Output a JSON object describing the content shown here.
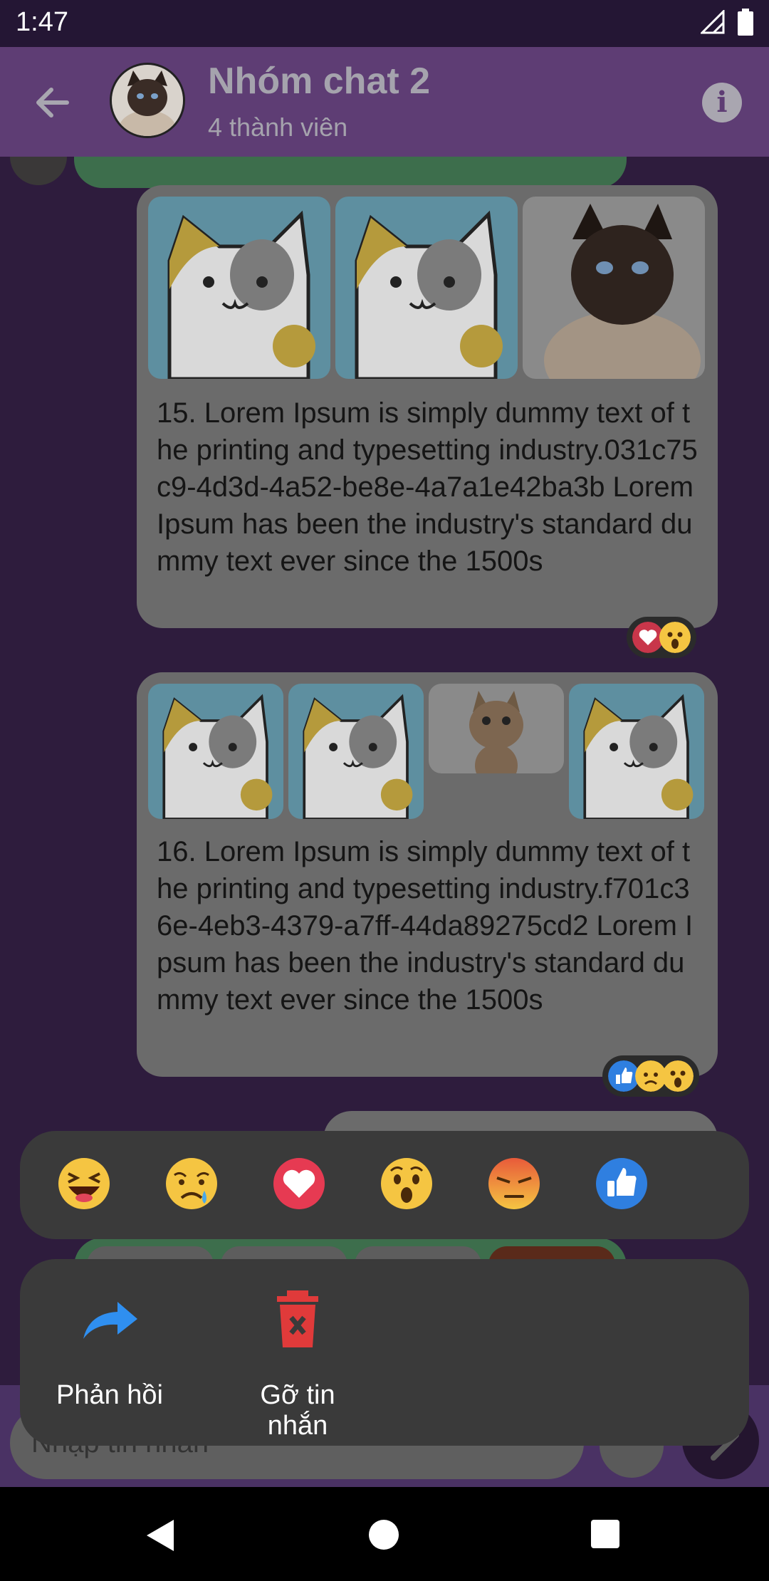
{
  "status_bar": {
    "time": "1:47"
  },
  "header": {
    "title": "Nhóm chat 2",
    "subtitle": "4 thành viên"
  },
  "messages": [
    {
      "text": "15. Lorem Ipsum is simply dummy text of the printing and typesetting industry.031c75c9-4d3d-4a52-be8e-4a7a1e42ba3b Lorem Ipsum has been the industry's standard dummy text ever since the 1500s",
      "images": [
        "cartoon-cat",
        "cartoon-cat",
        "siamese-cat"
      ],
      "reactions": [
        "heart",
        "wow"
      ]
    },
    {
      "text": "16. Lorem Ipsum is simply dummy text of the printing and typesetting industry.f701c36e-4eb3-4379-a7ff-44da89275cd2 Lorem Ipsum has been the industry's standard dummy text ever since the 1500s",
      "images": [
        "cartoon-cat",
        "cartoon-cat",
        "tabby-cat",
        "cartoon-cat"
      ],
      "reactions": [
        "like",
        "sad",
        "wow"
      ]
    }
  ],
  "reaction_picker": [
    "haha",
    "sad",
    "love",
    "wow",
    "angry",
    "like"
  ],
  "actions": {
    "reply_label": "Phản hồi",
    "delete_label": "Gỡ tin nhắn"
  },
  "composer": {
    "placeholder": "Nhập tin nhắn"
  },
  "colors": {
    "app_bar": "#5e3d74",
    "chat_bg": "#2e1c3d",
    "bubble": "#6b6b6b",
    "sheet": "#3a3a3a",
    "reply_blue": "#2f8ff0",
    "delete_red": "#e03a3a"
  }
}
